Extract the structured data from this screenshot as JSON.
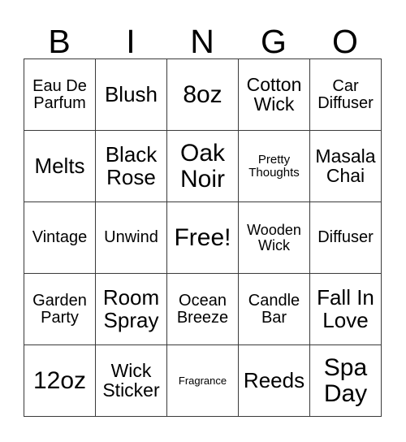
{
  "card": {
    "title_letters": [
      "B",
      "I",
      "N",
      "G",
      "O"
    ],
    "grid_size": "5x5",
    "free_space": "Free!",
    "colors": {
      "background": "#ffffff",
      "text": "#000000",
      "border": "#3a3a3a"
    },
    "rows": [
      [
        {
          "label": "Eau De Parfum",
          "size": "fs-ml"
        },
        {
          "label": "Blush",
          "size": "fs-xl"
        },
        {
          "label": "8oz",
          "size": "fs-xxl"
        },
        {
          "label": "Cotton Wick",
          "size": "fs-l"
        },
        {
          "label": "Car Diffuser",
          "size": "fs-ml"
        }
      ],
      [
        {
          "label": "Melts",
          "size": "fs-xl"
        },
        {
          "label": "Black Rose",
          "size": "fs-xl"
        },
        {
          "label": "Oak Noir",
          "size": "fs-xxl"
        },
        {
          "label": "Pretty Thoughts",
          "size": "fs-s"
        },
        {
          "label": "Masala Chai",
          "size": "fs-l"
        }
      ],
      [
        {
          "label": "Vintage",
          "size": "fs-ml"
        },
        {
          "label": "Unwind",
          "size": "fs-ml"
        },
        {
          "label": "Free!",
          "size": "fs-xxl"
        },
        {
          "label": "Wooden Wick",
          "size": "fs-m"
        },
        {
          "label": "Diffuser",
          "size": "fs-ml"
        }
      ],
      [
        {
          "label": "Garden Party",
          "size": "fs-ml"
        },
        {
          "label": "Room Spray",
          "size": "fs-xl"
        },
        {
          "label": "Ocean Breeze",
          "size": "fs-ml"
        },
        {
          "label": "Candle Bar",
          "size": "fs-ml"
        },
        {
          "label": "Fall In Love",
          "size": "fs-xl"
        }
      ],
      [
        {
          "label": "12oz",
          "size": "fs-xxl"
        },
        {
          "label": "Wick Sticker",
          "size": "fs-l"
        },
        {
          "label": "Fragrance",
          "size": "fs-xs"
        },
        {
          "label": "Reeds",
          "size": "fs-xl"
        },
        {
          "label": "Spa Day",
          "size": "fs-xxl"
        }
      ]
    ]
  }
}
